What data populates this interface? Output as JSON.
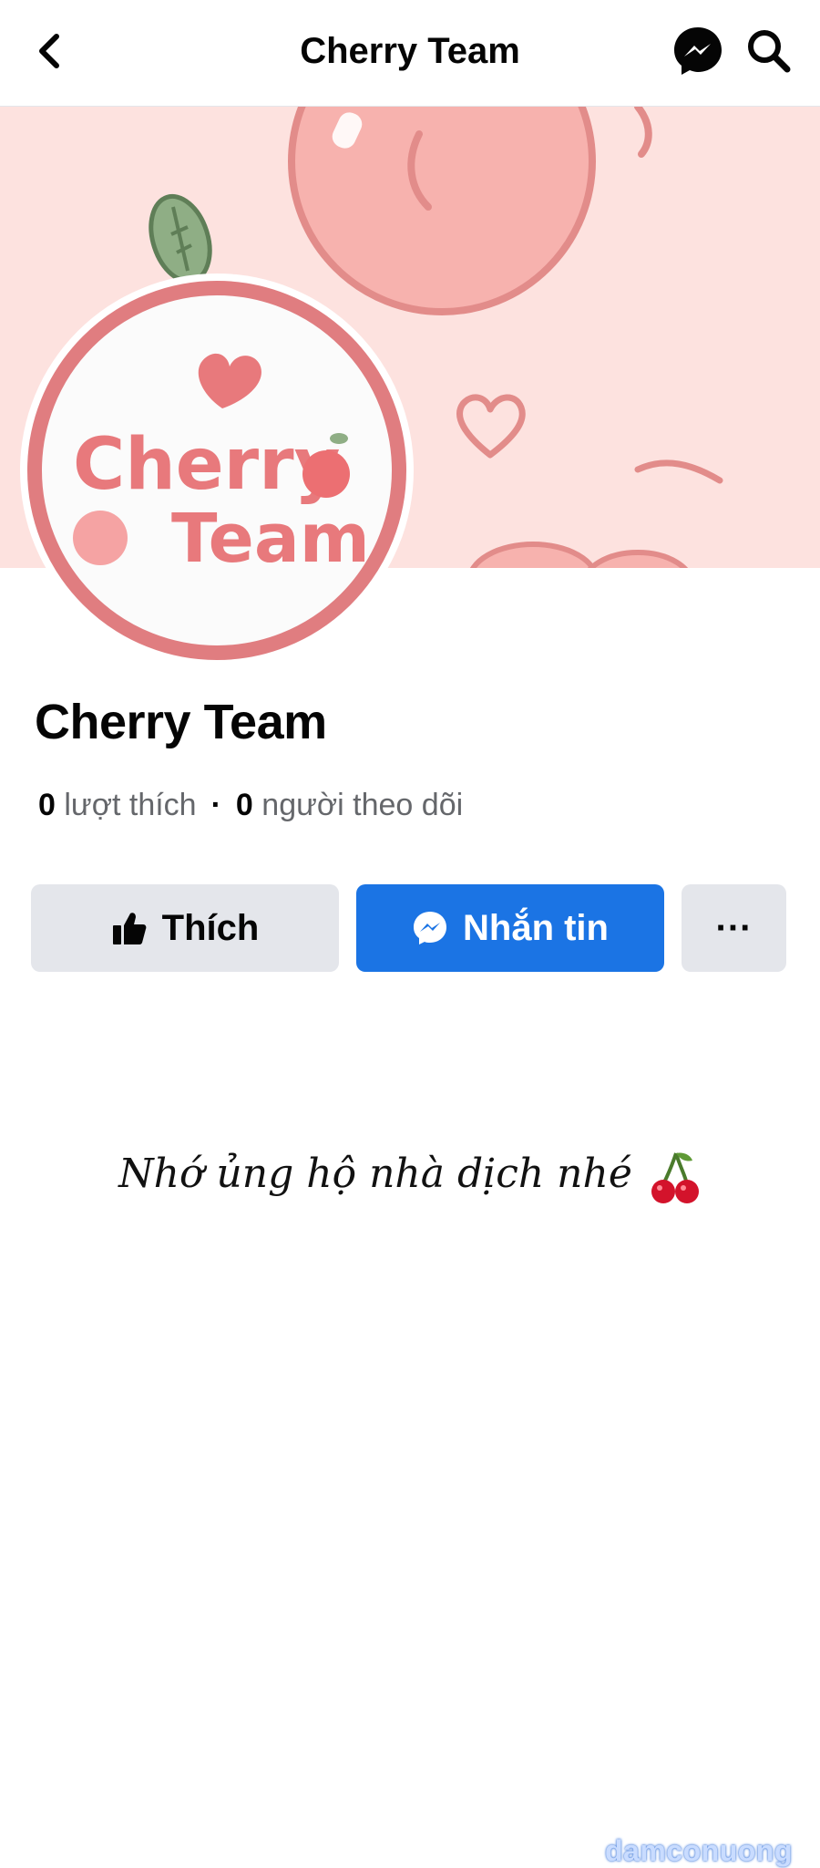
{
  "header": {
    "title": "Cherry Team",
    "back_icon": "chevron-left-icon",
    "messenger_icon": "messenger-icon",
    "search_icon": "search-icon"
  },
  "cover": {
    "bg_color": "#fde2df"
  },
  "avatar": {
    "logo_line1": "Cherry",
    "logo_line2": "Team"
  },
  "profile": {
    "name": "Cherry Team",
    "likes_count": "0",
    "likes_label": "lượt thích",
    "followers_count": "0",
    "followers_label": "người theo dõi"
  },
  "actions": {
    "like_label": "Thích",
    "message_label": "Nhắn tin",
    "more_label": "···"
  },
  "note": {
    "text": "Nhớ ủng hộ nhà dịch nhé"
  },
  "watermark": "damconuong",
  "colors": {
    "primary": "#1b74e4",
    "secondary_btn": "#e4e6eb",
    "logo_pink": "#e07d80"
  }
}
